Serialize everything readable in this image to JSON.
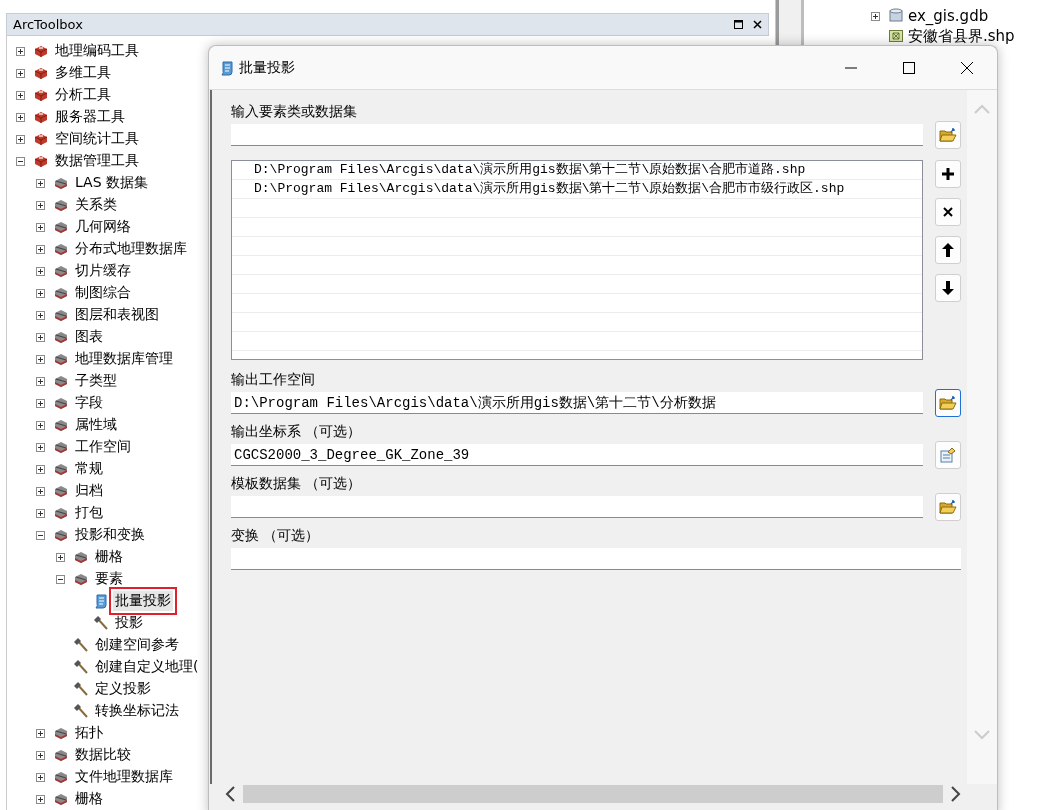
{
  "toolbox_panel": {
    "title": "ArcToolbox",
    "tree": [
      {
        "label": "地理编码工具",
        "kind": "toolbox",
        "expanded": false
      },
      {
        "label": "多维工具",
        "kind": "toolbox",
        "expanded": false
      },
      {
        "label": "分析工具",
        "kind": "toolbox",
        "expanded": false
      },
      {
        "label": "服务器工具",
        "kind": "toolbox",
        "expanded": false
      },
      {
        "label": "空间统计工具",
        "kind": "toolbox",
        "expanded": false
      },
      {
        "label": "数据管理工具",
        "kind": "toolbox",
        "expanded": true,
        "children": [
          {
            "label": "LAS 数据集",
            "kind": "toolset",
            "expanded": false
          },
          {
            "label": "关系类",
            "kind": "toolset",
            "expanded": false
          },
          {
            "label": "几何网络",
            "kind": "toolset",
            "expanded": false
          },
          {
            "label": "分布式地理数据库",
            "kind": "toolset",
            "expanded": false
          },
          {
            "label": "切片缓存",
            "kind": "toolset",
            "expanded": false
          },
          {
            "label": "制图综合",
            "kind": "toolset",
            "expanded": false
          },
          {
            "label": "图层和表视图",
            "kind": "toolset",
            "expanded": false
          },
          {
            "label": "图表",
            "kind": "toolset",
            "expanded": false
          },
          {
            "label": "地理数据库管理",
            "kind": "toolset",
            "expanded": false
          },
          {
            "label": "子类型",
            "kind": "toolset",
            "expanded": false
          },
          {
            "label": "字段",
            "kind": "toolset",
            "expanded": false
          },
          {
            "label": "属性域",
            "kind": "toolset",
            "expanded": false
          },
          {
            "label": "工作空间",
            "kind": "toolset",
            "expanded": false
          },
          {
            "label": "常规",
            "kind": "toolset",
            "expanded": false
          },
          {
            "label": "归档",
            "kind": "toolset",
            "expanded": false
          },
          {
            "label": "打包",
            "kind": "toolset",
            "expanded": false
          },
          {
            "label": "投影和变换",
            "kind": "toolset",
            "expanded": true,
            "children": [
              {
                "label": "栅格",
                "kind": "toolset",
                "expanded": false
              },
              {
                "label": "要素",
                "kind": "toolset",
                "expanded": true,
                "children": [
                  {
                    "label": "批量投影",
                    "kind": "script",
                    "selected": true
                  },
                  {
                    "label": "投影",
                    "kind": "tool",
                    "selected": false
                  }
                ]
              },
              {
                "label": "创建空间参考",
                "kind": "tool",
                "selected": false
              },
              {
                "label": "创建自定义地理(",
                "kind": "tool",
                "selected": false
              },
              {
                "label": "定义投影",
                "kind": "tool",
                "selected": false
              },
              {
                "label": "转换坐标记法",
                "kind": "tool",
                "selected": false
              }
            ]
          },
          {
            "label": "拓扑",
            "kind": "toolset",
            "expanded": false
          },
          {
            "label": "数据比较",
            "kind": "toolset",
            "expanded": false
          },
          {
            "label": "文件地理数据库",
            "kind": "toolset",
            "expanded": false
          },
          {
            "label": "栅格",
            "kind": "toolset",
            "expanded": false
          }
        ]
      }
    ]
  },
  "catalog": {
    "items": [
      {
        "label": "ex_gis.gdb",
        "kind": "database",
        "expanded": false
      },
      {
        "label": "安徽省县界.shp",
        "kind": "shapefile"
      }
    ]
  },
  "dialog": {
    "title": "批量投影",
    "input": {
      "label": "输入要素类或数据集",
      "button": {
        "kind": "folder",
        "focused": false
      }
    },
    "input_list": [
      "D:\\Program Files\\Arcgis\\data\\演示所用gis数据\\第十二节\\原始数据\\合肥市道路.shp",
      "D:\\Program Files\\Arcgis\\data\\演示所用gis数据\\第十二节\\原始数据\\合肥市市级行政区.shp"
    ],
    "list_buttons": [
      {
        "kind": "add"
      },
      {
        "kind": "remove"
      },
      {
        "kind": "up"
      },
      {
        "kind": "down"
      }
    ],
    "fields": [
      {
        "label": "输出工作空间",
        "value": "D:\\Program Files\\Arcgis\\data\\演示所用gis数据\\第十二节\\分析数据",
        "button": {
          "kind": "folder",
          "focused": true
        }
      },
      {
        "label": "输出坐标系 （可选）",
        "value": "CGCS2000_3_Degree_GK_Zone_39",
        "button": {
          "kind": "coordinate",
          "focused": false
        }
      },
      {
        "label": "模板数据集 （可选）",
        "button": {
          "kind": "folder",
          "focused": false
        }
      },
      {
        "label": "变换 （可选）"
      }
    ]
  }
}
